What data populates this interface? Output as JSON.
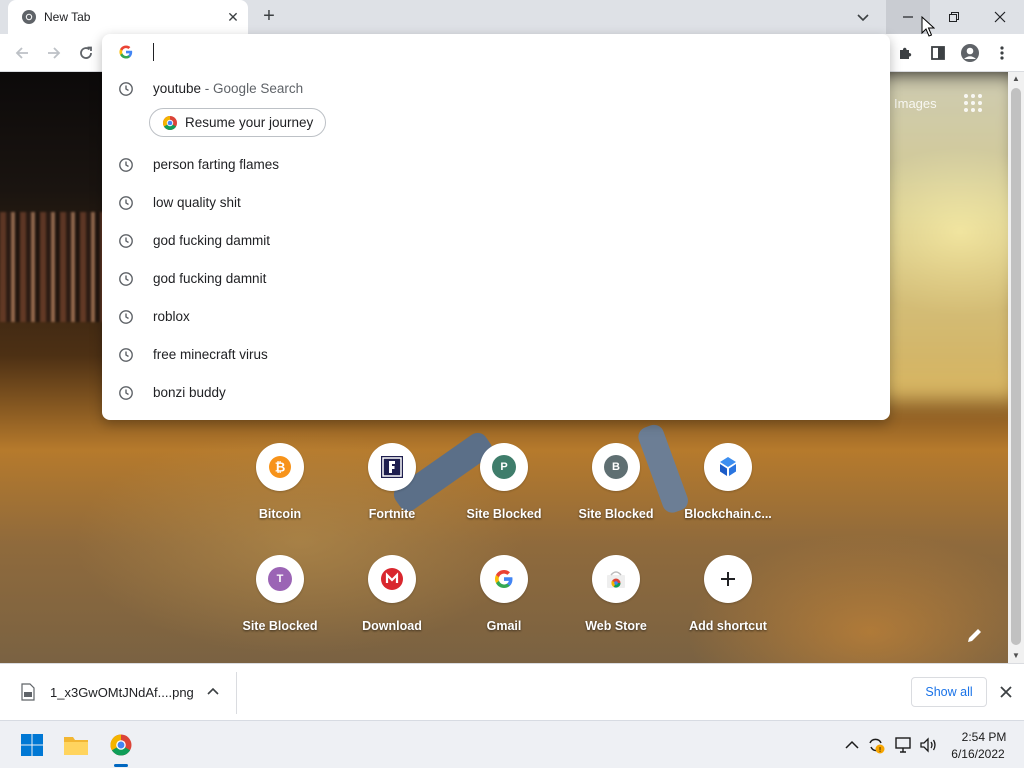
{
  "tab": {
    "title": "New Tab"
  },
  "omnibox": {
    "input_value": "",
    "suggestions": [
      {
        "text": "youtube",
        "desc": " - Google Search"
      },
      {
        "text": "person farting flames"
      },
      {
        "text": "low quality shit"
      },
      {
        "text": "god fucking dammit"
      },
      {
        "text": "god fucking damnit"
      },
      {
        "text": "roblox"
      },
      {
        "text": "free minecraft virus"
      },
      {
        "text": "bonzi buddy"
      }
    ],
    "journey_chip": "Resume your journey"
  },
  "page": {
    "images_link": "Images",
    "shortcuts": [
      {
        "label": "Bitcoin",
        "icon": "bitcoin-icon"
      },
      {
        "label": "Fortnite",
        "icon": "fortnite-icon"
      },
      {
        "label": "Site Blocked",
        "icon": "letter-p-icon",
        "letter": "P",
        "color": "#3f7d6b"
      },
      {
        "label": "Site Blocked",
        "icon": "letter-b-icon",
        "letter": "B",
        "color": "#5f6f72"
      },
      {
        "label": "Blockchain.c...",
        "icon": "blockchain-icon"
      },
      {
        "label": "Site Blocked",
        "icon": "letter-t-icon",
        "letter": "T",
        "color": "#9b64b5"
      },
      {
        "label": "Download",
        "icon": "mega-icon"
      },
      {
        "label": "Gmail",
        "icon": "google-icon"
      },
      {
        "label": "Web Store",
        "icon": "webstore-icon"
      },
      {
        "label": "Add shortcut",
        "icon": "plus-icon"
      }
    ]
  },
  "downloads": {
    "file_name": "1_x3GwOMtJNdAf....png",
    "show_all": "Show all"
  },
  "taskbar": {
    "time": "2:54 PM",
    "date": "6/16/2022"
  },
  "colors": {
    "accent": "#1a73e8",
    "taskbar_accent": "#0067c0"
  }
}
